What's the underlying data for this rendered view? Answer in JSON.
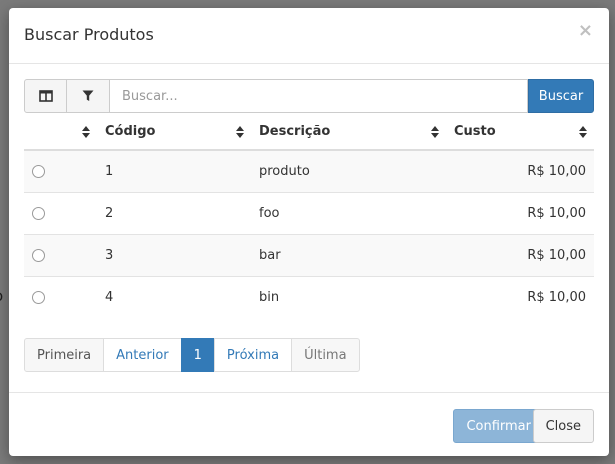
{
  "backdrop": {
    "text": "o"
  },
  "modal": {
    "title": "Buscar Produtos",
    "close_symbol": "×"
  },
  "toolbar": {
    "columns_icon": "columns-icon",
    "filter_icon": "filter-icon",
    "search_placeholder": "Buscar...",
    "search_value": "",
    "search_label": "Buscar"
  },
  "table": {
    "headers": [
      "",
      "Código",
      "Descrição",
      "Custo"
    ],
    "rows": [
      {
        "codigo": "1",
        "descricao": "produto",
        "custo": "R$ 10,00"
      },
      {
        "codigo": "2",
        "descricao": "foo",
        "custo": "R$ 10,00"
      },
      {
        "codigo": "3",
        "descricao": "bar",
        "custo": "R$ 10,00"
      },
      {
        "codigo": "4",
        "descricao": "bin",
        "custo": "R$ 10,00"
      }
    ]
  },
  "pagination": {
    "first": "Primeira",
    "prev": "Anterior",
    "current": "1",
    "next": "Próxima",
    "last": "Última"
  },
  "footer": {
    "confirm_label": "Confirmar",
    "close_label": "Close"
  },
  "colors": {
    "primary": "#337ab7",
    "primary_disabled": "#8db5d8",
    "backdrop": "#7a7a7a"
  }
}
